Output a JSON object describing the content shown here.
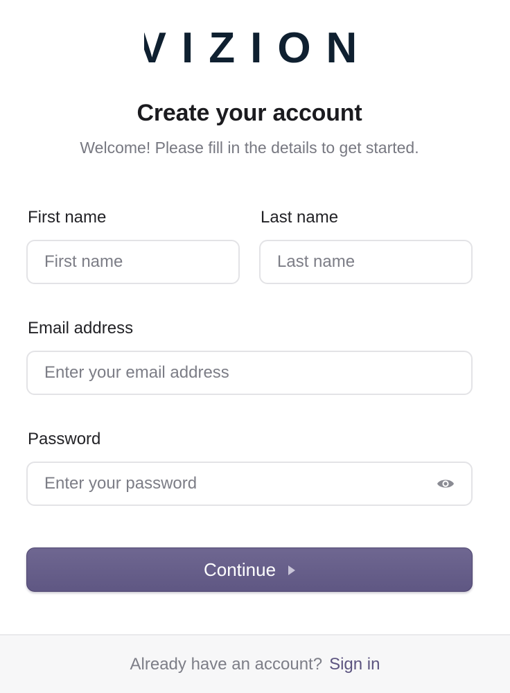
{
  "brand": {
    "name": "VIZION",
    "color": "#0f2030"
  },
  "header": {
    "title": "Create your account",
    "subtitle": "Welcome! Please fill in the details to get started."
  },
  "form": {
    "first_name": {
      "label": "First name",
      "placeholder": "First name",
      "value": ""
    },
    "last_name": {
      "label": "Last name",
      "placeholder": "Last name",
      "value": ""
    },
    "email": {
      "label": "Email address",
      "placeholder": "Enter your email address",
      "value": ""
    },
    "password": {
      "label": "Password",
      "placeholder": "Enter your password",
      "value": "",
      "toggle_icon": "eye-icon"
    },
    "submit": {
      "label": "Continue",
      "icon": "caret-right-icon",
      "color": "#675f8a"
    }
  },
  "footer": {
    "text": "Already have an account?",
    "link_label": "Sign in",
    "link_color": "#5c5480"
  }
}
